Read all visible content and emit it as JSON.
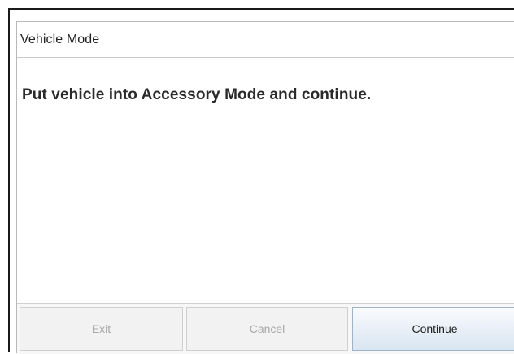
{
  "dialog": {
    "title": "Vehicle Mode",
    "message": "Put vehicle into Accessory Mode and continue."
  },
  "buttons": {
    "exit_label": "Exit",
    "cancel_label": "Cancel",
    "continue_label": "Continue"
  },
  "colors": {
    "frame_border": "#1a1a1a",
    "disabled_text": "#a8a8a8",
    "continue_button_border": "#9fb3c8"
  }
}
